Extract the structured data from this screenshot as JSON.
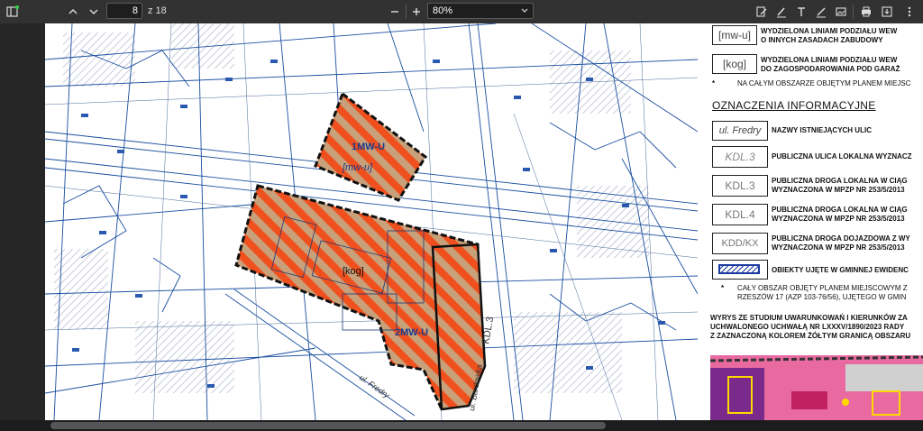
{
  "toolbar": {
    "page_current": "8",
    "page_total": "z 18",
    "zoom": "80%"
  },
  "map": {
    "labels": [
      {
        "text": "1MW-U"
      },
      {
        "text": "[mw-u]"
      },
      {
        "text": "[kog]"
      },
      {
        "text": "2MW-U"
      },
      {
        "text": "KDL.3"
      },
      {
        "text": "ul. Bardowka"
      },
      {
        "text": "ul. Fredry"
      }
    ]
  },
  "legend": {
    "row1_box": "[mw-u]",
    "row1_text1": "WYDZIELONA  LINIAMI PODZIAŁU WEW",
    "row1_text2": "O INNYCH ZASADACH ZABUDOWY",
    "row2_box": "[kog]",
    "row2_text1": "WYDZIELONA LINIAMI PODZIAŁU WEW",
    "row2_text2": "DO ZAGOSPODAROWANIA POD GARAŻ",
    "note1": "NA CAŁYM OBSZARZE OBJĘTYM PLANEM MIEJSC",
    "heading": "OZNACZENIA INFORMACYJNE",
    "info_rows": [
      {
        "box": "ul. Fredry",
        "text1": "NAZWY ISTNIEJĄCYCH ULIC",
        "text2": ""
      },
      {
        "box": "KDL.3",
        "text1": "PUBLICZNA ULICA LOKALNA WYZNACZ",
        "text2": ""
      },
      {
        "box": "KDL.3",
        "text1": "PUBLICZNA DROGA LOKALNA W CIĄG",
        "text2": "WYZNACZONA W MPZP NR 253/5/2013"
      },
      {
        "box": "KDL.4",
        "text1": "PUBLICZNA DROGA LOKALNA W CIĄG",
        "text2": "WYZNACZONA W MPZP NR 253/5/2013"
      },
      {
        "box": "KDD/KX",
        "text1": "PUBLICZNA DROGA DOJAZDOWA Z WY",
        "text2": "WYZNACZONA W MPZP NR 253/5/2013"
      },
      {
        "box": "",
        "text1": "OBIEKTY UJĘTE W GMINNEJ EWIDENC",
        "text2": ""
      }
    ],
    "note2_line1": "CAŁY OBSZAR OBJĘTY PLANEM MIEJSCOWYM Z",
    "note2_line2": "RZESZÓW 17 (AZP 103-76/56), UJĘTEGO W GMIN",
    "study_line1": "WYRYS ZE STUDIUM UWARUNKOWAŃ I KIERUNKÓW ZA",
    "study_line2": "UCHWALONEGO UCHWAŁĄ NR LXXXV/1890/2023 RADY",
    "study_line3": "Z ZAZNACZONĄ KOLOREM ŻÓŁTYM GRANICĄ OBSZARU"
  },
  "colors": {
    "toolbar_bg": "#323232",
    "plan_orange": "#f0501e",
    "plan_tan": "#c8a07a",
    "map_blue": "#1a4fa0"
  }
}
